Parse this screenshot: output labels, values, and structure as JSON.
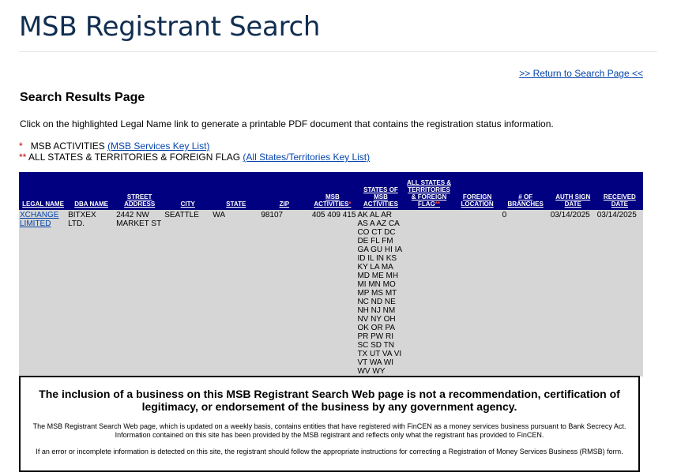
{
  "page_title": "MSB Registrant Search",
  "return_link": ">> Return to Search Page <<",
  "results_heading": "Search Results Page",
  "instructions": "Click on the highlighted Legal Name link to generate a printable PDF document that contains the registration status information.",
  "legend": {
    "msb_marker": "*",
    "msb_text": "MSB ACTIVITIES",
    "msb_link": "(MSB Services Key List)",
    "states_marker": "**",
    "states_text": "ALL STATES & TERRITORIES & FOREIGN FLAG",
    "states_link": "(All States/Territories Key List)"
  },
  "table": {
    "headers": {
      "legal_name": "LEGAL NAME",
      "dba_name": "DBA NAME",
      "street_address": "STREET ADDRESS",
      "city": "CITY",
      "state": "STATE",
      "zip": "ZIP",
      "msb_activities": "MSB ACTIVITIES",
      "states_of_msb": "STATES OF MSB ACTIVITIES",
      "all_states": "ALL STATES & TERRITORIES & FOREIGN FLAG",
      "foreign_location": "FOREIGN LOCATION",
      "num_branches": "# OF BRANCHES",
      "auth_sign_date": "AUTH SIGN DATE",
      "received_date": "RECEIVED DATE"
    },
    "rows": [
      {
        "legal_name": "XCHANGE LIMITED",
        "dba_name": "BITXEX LTD.",
        "street_address": "2442 NW MARKET ST",
        "city": "SEATTLE",
        "state": "WA",
        "zip": "98107",
        "msb_activities": "405 409 415",
        "states_of_msb": "AK AL AR AS A AZ CA CO CT DC DE FL FM GA GU HI IA ID IL IN KS KY LA MA MD ME MH MI MN MO MP MS MT NC ND NE NH NJ NM NV NY OH OK OR PA PR PW RI SC SD TN TX UT VA VI VT WA WI WV WY",
        "all_states": "",
        "foreign_location": "",
        "num_branches": "0",
        "auth_sign_date": "03/14/2025",
        "received_date": "03/14/2025"
      }
    ]
  },
  "disclaimer": {
    "headline": "The inclusion of a business on this MSB Registrant Search Web page is not a recommendation, certification of legitimacy, or endorsement of the business by any government agency.",
    "p1": "The MSB Registrant Search Web page, which is updated on a weekly basis, contains entities that have registered with FinCEN as a money services business pursuant to Bank Secrecy Act. Information contained on this site has been provided by the MSB registrant and reflects only what the registrant has provided to FinCEN.",
    "p2": "If an error or incomplete information is detected on this site, the registrant should follow the appropriate instructions for correcting a Registration of Money Services Business (RMSB) form."
  }
}
